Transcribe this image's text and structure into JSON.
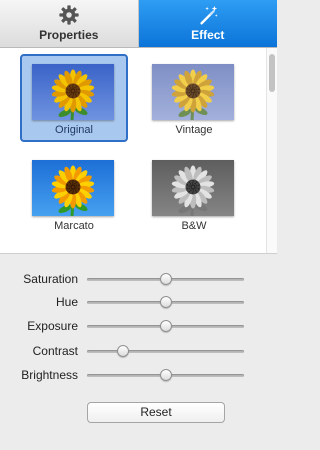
{
  "tabs": [
    {
      "label": "Properties",
      "icon": "gear-icon",
      "active": false
    },
    {
      "label": "Effect",
      "icon": "magic-wand-icon",
      "active": true
    }
  ],
  "effects": [
    {
      "label": "Original",
      "selected": true,
      "style": "original"
    },
    {
      "label": "Vintage",
      "selected": false,
      "style": "vintage"
    },
    {
      "label": "Marcato",
      "selected": false,
      "style": "marcato"
    },
    {
      "label": "B&W",
      "selected": false,
      "style": "bw"
    }
  ],
  "adjustments": [
    {
      "label": "Saturation",
      "value": 0.5
    },
    {
      "label": "Hue",
      "value": 0.5
    },
    {
      "label": "Exposure",
      "value": 0.5
    },
    {
      "label": "Contrast",
      "value": 0.23
    },
    {
      "label": "Brightness",
      "value": 0.5
    }
  ],
  "reset_label": "Reset",
  "colors": {
    "accent": "#1a86e6",
    "selection_fill": "#a9c8ef",
    "selection_border": "#2f6fc6"
  }
}
